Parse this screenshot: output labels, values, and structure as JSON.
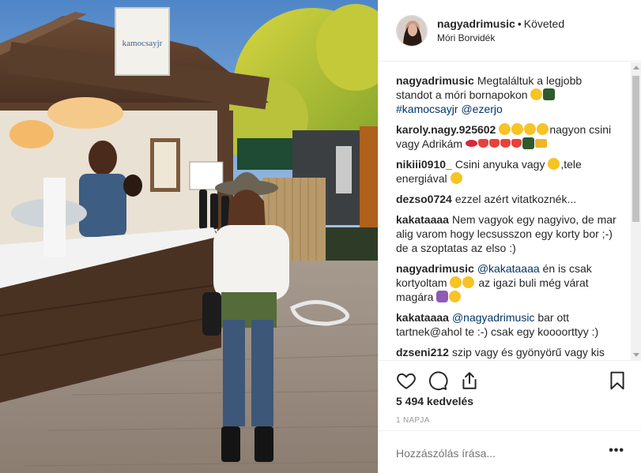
{
  "post": {
    "username": "nagyadrimusic",
    "follow_status": "Követed",
    "location": "Móri Borvidék",
    "sign_text": "kamocsayjr",
    "likes": "5 494 kedvelés",
    "time_ago": "1 NAPJA",
    "add_comment_placeholder": "Hozzászólás írása...",
    "more_label": "•••"
  },
  "comments": [
    {
      "user": "nagyadrimusic",
      "text": "Megtaláltuk a legjobb standot a móri bornapokon",
      "emojis": [
        "smile",
        "dancer"
      ],
      "tags": "#kamocsayjr @ezerjo"
    },
    {
      "user": "karoly.nagy.925602",
      "text": "nagyon csini vagy Adrikám",
      "pre_emojis": [
        "heart-eyes",
        "heart-eyes",
        "heart-eyes",
        "kiss"
      ],
      "emojis": [
        "lips",
        "heart",
        "heart",
        "heart",
        "heart",
        "cactus",
        "crown"
      ]
    },
    {
      "user": "nikiii0910_",
      "text": "Csini anyuka vagy",
      "text2": ",tele energiával",
      "emojis": [
        "smile"
      ],
      "emojis2": [
        "smile"
      ]
    },
    {
      "user": "dezso0724",
      "text": "ezzel azért vitatkoznék..."
    },
    {
      "user": "kakataaaa",
      "text": "Nem vagyok egy nagyivo, de mar alig varom hogy lecsusszon egy korty bor ;-) de a szoptatas az elso :)"
    },
    {
      "user": "nagyadrimusic",
      "tag": "@kakataaaa",
      "text": "én is csak kortyoltam",
      "text2": "az igazi buli még várat magára",
      "emojis": [
        "thumb",
        "grin"
      ],
      "emojis2": [
        "woman",
        "laugh"
      ]
    },
    {
      "user": "kakataaaa",
      "tag": "@nagyadrimusic",
      "text": "bar ott tartnek@ahol te :-) csak egy koooorttyy :)"
    },
    {
      "user": "dzseni212",
      "text": "szip vagy és gyönyörű vagy kis hercegnő"
    }
  ],
  "colors": {
    "link": "#003569",
    "muted": "#999999",
    "text": "#262626",
    "border": "#efefef"
  },
  "icons": [
    "heart-icon",
    "comment-icon",
    "share-icon",
    "bookmark-icon"
  ]
}
